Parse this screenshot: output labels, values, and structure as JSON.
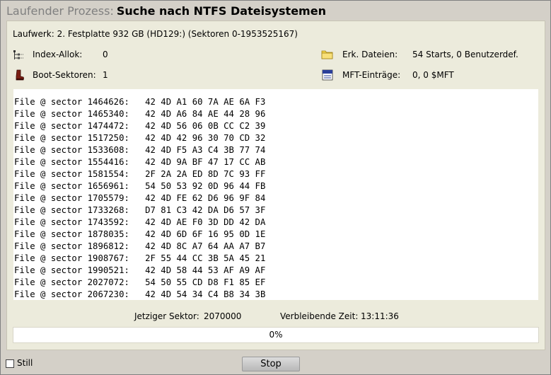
{
  "title": {
    "label": "Laufender Prozess:",
    "task": "Suche nach NTFS Dateisystemen"
  },
  "drive": "Laufwerk: 2. Festplatte 932 GB (HD129:) (Sektoren 0-1953525167)",
  "stats": {
    "index_alloc": {
      "label": "Index-Allok:",
      "value": "0"
    },
    "boot_sectors": {
      "label": "Boot-Sektoren:",
      "value": "1"
    },
    "found_files": {
      "label": "Erk. Dateien:",
      "value": "54 Starts, 0 Benutzerdef."
    },
    "mft_entries": {
      "label": "MFT-Einträge:",
      "value": "0, 0 $MFT"
    }
  },
  "icons": {
    "index_alloc": "tree-icon",
    "boot_sectors": "boot-icon",
    "found_files": "folder-icon",
    "mft_entries": "file-icon"
  },
  "log": [
    "File @ sector 1464626:   42 4D A1 60 7A AE 6A F3",
    "File @ sector 1465340:   42 4D A6 84 AE 44 28 96",
    "File @ sector 1474472:   42 4D 56 06 0B CC C2 39",
    "File @ sector 1517250:   42 4D 42 96 30 70 CD 32",
    "File @ sector 1533608:   42 4D F5 A3 C4 3B 77 74",
    "File @ sector 1554416:   42 4D 9A BF 47 17 CC AB",
    "File @ sector 1581554:   2F 2A 2A ED 8D 7C 93 FF",
    "File @ sector 1656961:   54 50 53 92 0D 96 44 FB",
    "File @ sector 1705579:   42 4D FE 62 D6 96 9F 84",
    "File @ sector 1733268:   D7 81 C3 42 DA D6 57 3F",
    "File @ sector 1743592:   42 4D AE F0 3D DD 42 DA",
    "File @ sector 1878035:   42 4D 6D 6F 16 95 0D 1E",
    "File @ sector 1896812:   42 4D 8C A7 64 AA A7 B7",
    "File @ sector 1908767:   2F 55 44 CC 3B 5A 45 21",
    "File @ sector 1990521:   42 4D 58 44 53 AF A9 AF",
    "File @ sector 2027072:   54 50 55 CD D8 F1 85 EF",
    "File @ sector 2067230:   42 4D 54 34 C4 B8 34 3B"
  ],
  "current_sector": {
    "label": "Jetziger Sektor:",
    "value": "2070000"
  },
  "remaining_time": {
    "label": "Verbleibende Zeit:",
    "value": "13:11:36"
  },
  "progress": {
    "text": "0%",
    "fraction": 0
  },
  "still": {
    "label": "Still",
    "checked": false
  },
  "stop_label": "Stop",
  "colors": {
    "window_bg": "#d4d0c8",
    "panel_bg": "#ecebdc",
    "title_label": "#808080"
  }
}
